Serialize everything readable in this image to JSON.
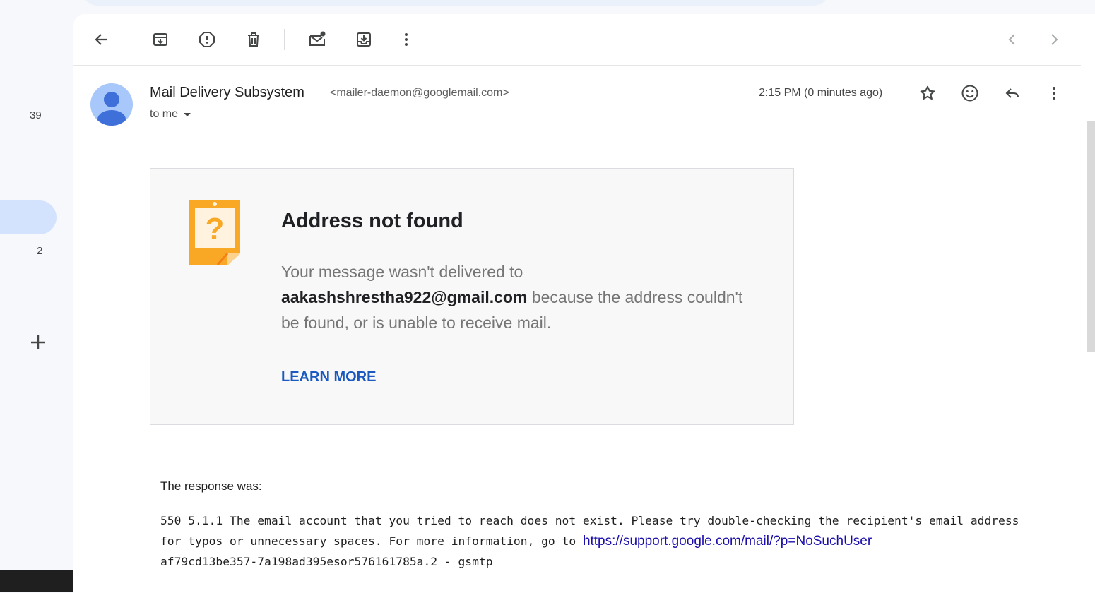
{
  "rail": {
    "count_top": "39",
    "count_active_below": "2"
  },
  "message": {
    "sender_name": "Mail Delivery Subsystem",
    "sender_email": "<mailer-daemon@googlemail.com>",
    "to": "to me",
    "timestamp": "2:15 PM (0 minutes ago)"
  },
  "bounce": {
    "title": "Address not found",
    "body_prefix": "Your message wasn't delivered to",
    "address": "aakashshrestha922@gmail.com",
    "body_suffix": "because the address couldn't be found, or is unable to receive mail.",
    "learn_more": "LEARN MORE"
  },
  "response": {
    "label": "The response was:",
    "text_before_link": "550 5.1.1 The email account that you tried to reach does not exist. Please try double-checking the recipient's email address for typos or unnecessary spaces. For more information, go to ",
    "link": "https://support.google.com/mail/?p=NoSuchUser",
    "text_after_link": "af79cd13be357-7a198ad395esor576161785a.2 - gsmtp"
  },
  "icons": {
    "toolbar": [
      "back-arrow-icon",
      "archive-icon",
      "report-spam-icon",
      "delete-icon",
      "mark-unread-icon",
      "move-to-icon",
      "more-vert-icon",
      "chevron-left-icon",
      "chevron-right-icon"
    ],
    "header": [
      "star-icon",
      "emoji-icon",
      "reply-icon",
      "more-vert-icon"
    ]
  },
  "colors": {
    "accent_blue": "#1a5ac0",
    "warning_orange": "#f9a825",
    "active_nav": "#d3e3fd",
    "link": "#1a0dab"
  }
}
